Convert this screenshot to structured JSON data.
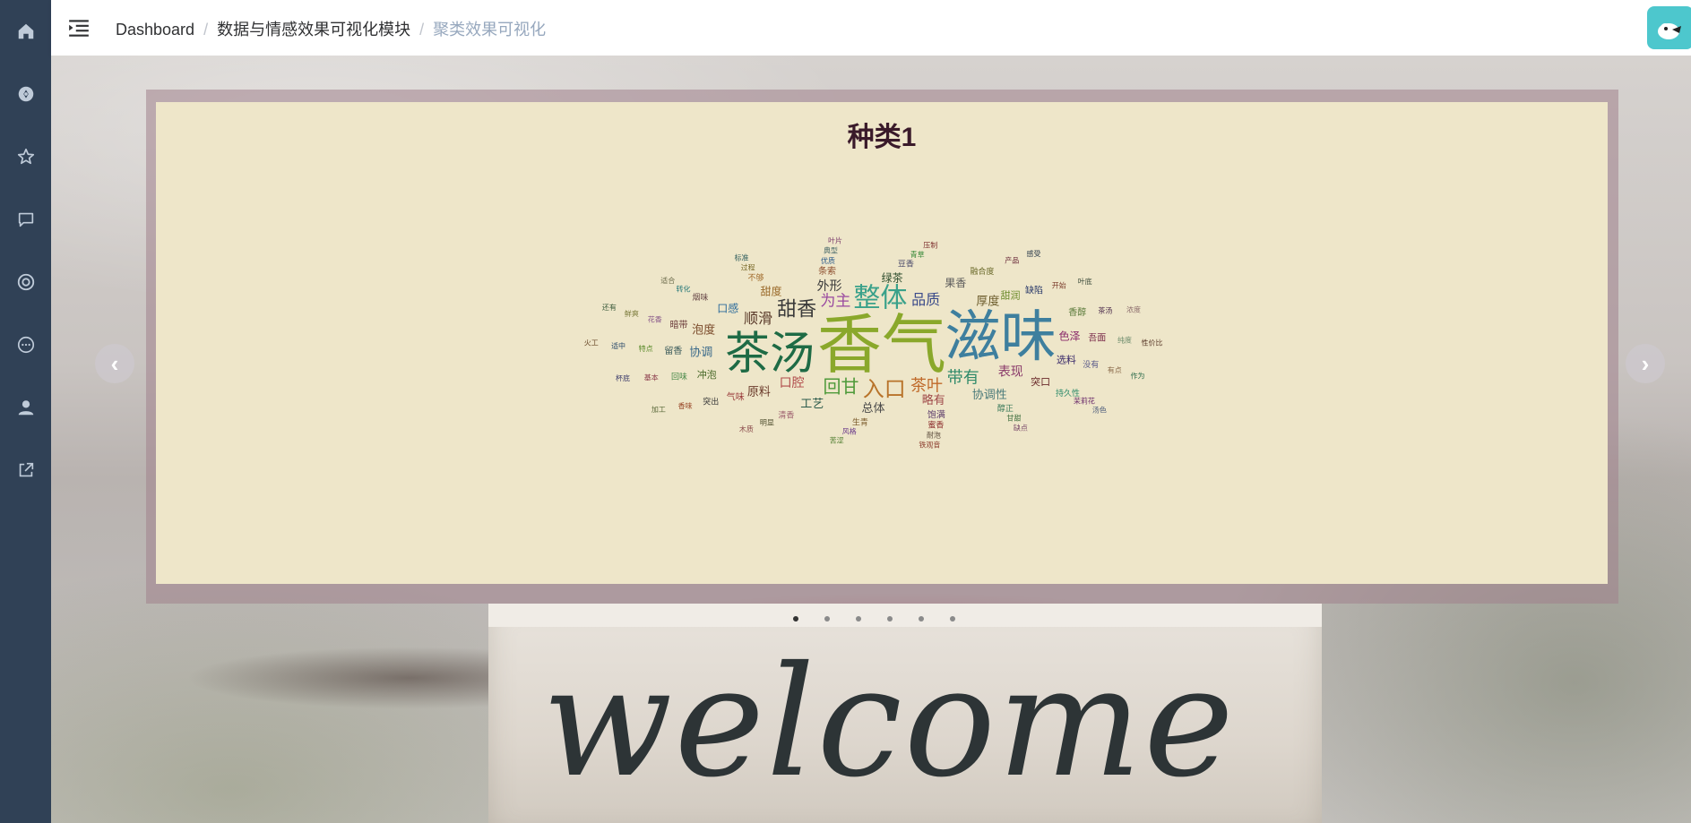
{
  "breadcrumb": {
    "items": [
      "Dashboard",
      "数据与情感效果可视化模块",
      "聚类效果可视化"
    ],
    "separator": "/"
  },
  "sidebar": {
    "icons": [
      "home-icon",
      "compass-icon",
      "star-icon",
      "message-icon",
      "lifebuoy-icon",
      "chat-icon",
      "user-icon",
      "external-link-icon"
    ]
  },
  "carousel": {
    "slide_title": "种类1",
    "prev_glyph": "‹",
    "next_glyph": "›",
    "dot_count": 6,
    "active_dot": 0
  },
  "wordcloud": {
    "words": [
      {
        "text": "香气",
        "size": 72,
        "color": "#8aa82b"
      },
      {
        "text": "滋味",
        "size": 62,
        "color": "#3e7f9e"
      },
      {
        "text": "茶汤",
        "size": 50,
        "color": "#1e6b45"
      },
      {
        "text": "整体",
        "size": 30,
        "color": "#3aa18a"
      },
      {
        "text": "入口",
        "size": 24,
        "color": "#b8732a"
      },
      {
        "text": "甜香",
        "size": 22,
        "color": "#3a3a3a"
      },
      {
        "text": "回甘",
        "size": 20,
        "color": "#4f9a3a"
      },
      {
        "text": "带有",
        "size": 18,
        "color": "#2f8a6a"
      },
      {
        "text": "茶叶",
        "size": 18,
        "color": "#c06a2a"
      },
      {
        "text": "为主",
        "size": 17,
        "color": "#9a4aa0"
      },
      {
        "text": "品质",
        "size": 16,
        "color": "#3a4a8a"
      },
      {
        "text": "顺滑",
        "size": 16,
        "color": "#5a3a2a"
      },
      {
        "text": "口腔",
        "size": 14,
        "color": "#b04a4a"
      },
      {
        "text": "表现",
        "size": 14,
        "color": "#8a3a6a"
      },
      {
        "text": "外形",
        "size": 14,
        "color": "#3a3a3a"
      },
      {
        "text": "厚度",
        "size": 13,
        "color": "#6a5a2a"
      },
      {
        "text": "略有",
        "size": 13,
        "color": "#a04a4a"
      },
      {
        "text": "协调性",
        "size": 13,
        "color": "#4a7a7a"
      },
      {
        "text": "总体",
        "size": 13,
        "color": "#4a4a4a"
      },
      {
        "text": "工艺",
        "size": 13,
        "color": "#2a5a4a"
      },
      {
        "text": "原料",
        "size": 13,
        "color": "#6a3a2a"
      },
      {
        "text": "协调",
        "size": 13,
        "color": "#3a6a8a"
      },
      {
        "text": "泡度",
        "size": 13,
        "color": "#7a4a2a"
      },
      {
        "text": "口感",
        "size": 12,
        "color": "#2a6a9a"
      },
      {
        "text": "甜度",
        "size": 12,
        "color": "#9a6a2a"
      },
      {
        "text": "绿茶",
        "size": 12,
        "color": "#2a4a2a"
      },
      {
        "text": "果香",
        "size": 12,
        "color": "#5a5a5a"
      },
      {
        "text": "色泽",
        "size": 12,
        "color": "#8a2a6a"
      },
      {
        "text": "甜润",
        "size": 11,
        "color": "#6a8a2a"
      },
      {
        "text": "选料",
        "size": 11,
        "color": "#3a2a6a"
      },
      {
        "text": "突口",
        "size": 11,
        "color": "#6a2a2a"
      },
      {
        "text": "冲泡",
        "size": 11,
        "color": "#4a6a2a"
      },
      {
        "text": "饱满",
        "size": 10,
        "color": "#5a3a6a"
      },
      {
        "text": "气味",
        "size": 10,
        "color": "#9a3a3a"
      },
      {
        "text": "留香",
        "size": 10,
        "color": "#3a5a5a"
      },
      {
        "text": "暗带",
        "size": 10,
        "color": "#6a3a3a"
      },
      {
        "text": "条索",
        "size": 10,
        "color": "#8a4a2a"
      },
      {
        "text": "缺陷",
        "size": 10,
        "color": "#2a3a6a"
      },
      {
        "text": "香醇",
        "size": 10,
        "color": "#5a7a3a"
      },
      {
        "text": "吾面",
        "size": 10,
        "color": "#7a2a4a"
      },
      {
        "text": "没有",
        "size": 9,
        "color": "#5a5a8a"
      },
      {
        "text": "醇正",
        "size": 9,
        "color": "#3a7a5a"
      },
      {
        "text": "生青",
        "size": 9,
        "color": "#7a5a2a"
      },
      {
        "text": "清香",
        "size": 9,
        "color": "#9a5a6a"
      },
      {
        "text": "回味",
        "size": 9,
        "color": "#4a8a4a"
      },
      {
        "text": "烟味",
        "size": 9,
        "color": "#6a4a4a"
      },
      {
        "text": "不够",
        "size": 9,
        "color": "#a06a2a"
      },
      {
        "text": "豆香",
        "size": 9,
        "color": "#4a4a6a"
      },
      {
        "text": "融合度",
        "size": 9,
        "color": "#6a6a2a"
      },
      {
        "text": "持久性",
        "size": 9,
        "color": "#2a8a6a"
      },
      {
        "text": "蜜香",
        "size": 9,
        "color": "#8a2a2a"
      },
      {
        "text": "突出",
        "size": 9,
        "color": "#3a3a3a"
      },
      {
        "text": "特点",
        "size": 8,
        "color": "#5a8a2a"
      },
      {
        "text": "花香",
        "size": 8,
        "color": "#8a5a8a"
      },
      {
        "text": "优质",
        "size": 8,
        "color": "#2a5a8a"
      },
      {
        "text": "开始",
        "size": 8,
        "color": "#7a3a2a"
      },
      {
        "text": "茶汤",
        "size": 8,
        "color": "#4a2a4a"
      },
      {
        "text": "纯度",
        "size": 8,
        "color": "#6a8a6a"
      },
      {
        "text": "有点",
        "size": 8,
        "color": "#8a6a4a"
      },
      {
        "text": "甘甜",
        "size": 8,
        "color": "#3a6a3a"
      },
      {
        "text": "风格",
        "size": 8,
        "color": "#6a3a8a"
      },
      {
        "text": "明显",
        "size": 8,
        "color": "#4a4a2a"
      },
      {
        "text": "基本",
        "size": 8,
        "color": "#8a3a4a"
      },
      {
        "text": "转化",
        "size": 8,
        "color": "#2a7a7a"
      },
      {
        "text": "过程",
        "size": 8,
        "color": "#7a6a2a"
      },
      {
        "text": "青草",
        "size": 8,
        "color": "#3a8a3a"
      },
      {
        "text": "茉莉花",
        "size": 8,
        "color": "#6a2a6a"
      },
      {
        "text": "耐泡",
        "size": 8,
        "color": "#5a4a3a"
      },
      {
        "text": "香味",
        "size": 8,
        "color": "#9a4a2a"
      },
      {
        "text": "适中",
        "size": 8,
        "color": "#2a4a6a"
      },
      {
        "text": "鲜爽",
        "size": 8,
        "color": "#7a7a3a"
      },
      {
        "text": "典型",
        "size": 8,
        "color": "#4a6a6a"
      },
      {
        "text": "产品",
        "size": 8,
        "color": "#6a2a3a"
      },
      {
        "text": "叶底",
        "size": 8,
        "color": "#3a4a3a"
      },
      {
        "text": "浓度",
        "size": 8,
        "color": "#8a6a6a"
      },
      {
        "text": "性价比",
        "size": 8,
        "color": "#5a3a2a"
      },
      {
        "text": "作为",
        "size": 8,
        "color": "#2a6a4a"
      },
      {
        "text": "缺点",
        "size": 8,
        "color": "#7a4a6a"
      },
      {
        "text": "苦涩",
        "size": 8,
        "color": "#4a7a2a"
      },
      {
        "text": "木质",
        "size": 8,
        "color": "#8a4a4a"
      },
      {
        "text": "杯底",
        "size": 8,
        "color": "#3a3a6a"
      },
      {
        "text": "适合",
        "size": 8,
        "color": "#6a6a4a"
      },
      {
        "text": "标准",
        "size": 8,
        "color": "#2a5a5a"
      },
      {
        "text": "压制",
        "size": 8,
        "color": "#7a2a2a"
      },
      {
        "text": "汤色",
        "size": 8,
        "color": "#4a5a7a"
      },
      {
        "text": "铁观音",
        "size": 8,
        "color": "#8a3a2a"
      },
      {
        "text": "加工",
        "size": 8,
        "color": "#5a6a3a"
      },
      {
        "text": "火工",
        "size": 8,
        "color": "#6a4a2a"
      },
      {
        "text": "还有",
        "size": 8,
        "color": "#3a5a3a"
      },
      {
        "text": "叶片",
        "size": 8,
        "color": "#7a3a6a"
      },
      {
        "text": "感受",
        "size": 8,
        "color": "#2a3a4a"
      }
    ]
  }
}
